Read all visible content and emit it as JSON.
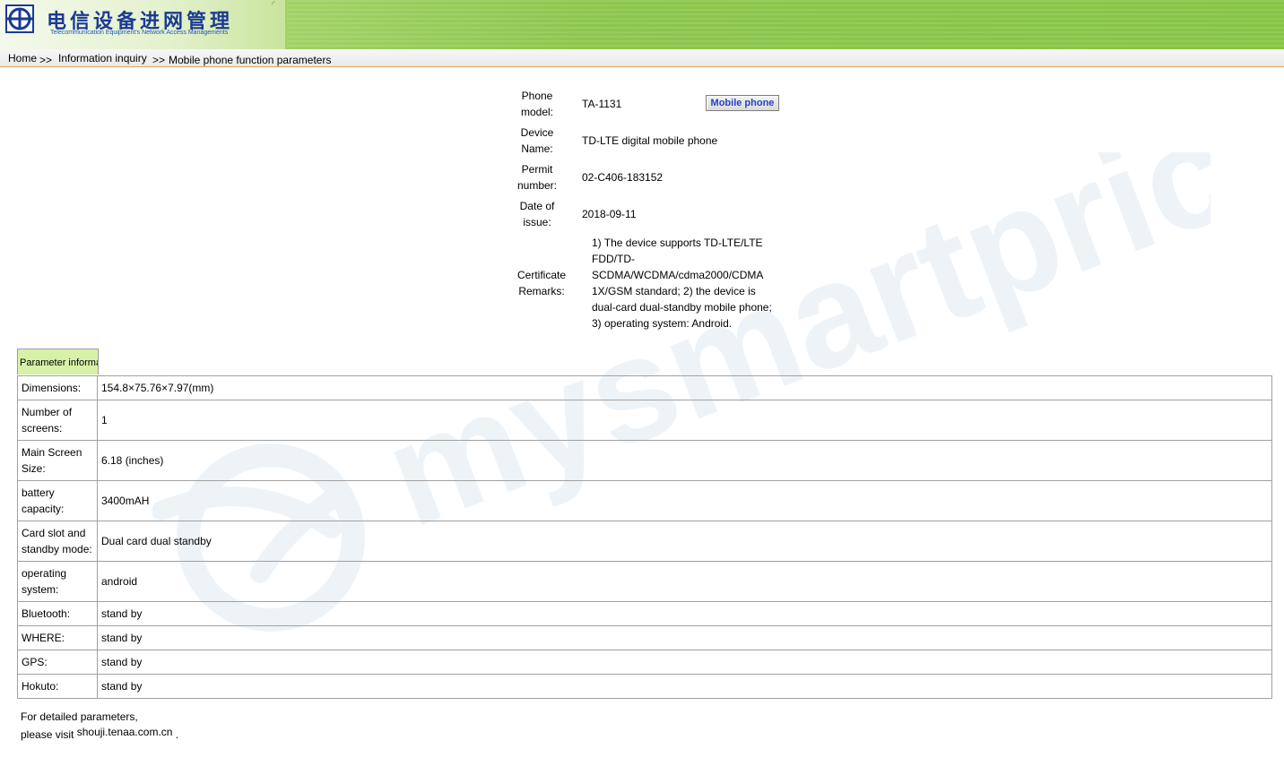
{
  "header": {
    "title_cn": "电信设备进网管理",
    "title_en": "Telecommunication Equipment's Network Access Managements"
  },
  "breadcrumb": {
    "home": "Home",
    "sep1": ">>",
    "info": "Information inquiry",
    "sep2": ">>",
    "current": "Mobile phone function parameters"
  },
  "certificate": {
    "phone_model_label": "Phone model:",
    "phone_model": "TA-1131",
    "type_button": "Mobile phone",
    "device_name_label": "Device Name:",
    "device_name": "TD-LTE digital mobile phone",
    "permit_label": "Permit number:",
    "permit_number": "02-C406-183152",
    "date_label": "Date of issue:",
    "date": "2018-09-11",
    "remarks_label": "Certificate Remarks:",
    "remarks": "1) The device supports TD-LTE/LTE FDD/TD-SCDMA/WCDMA/cdma2000/CDMA 1X/GSM standard; 2) the device is dual-card dual-standby mobile phone; 3) operating system: Android."
  },
  "parameters": {
    "tab_label": "Parameter information",
    "rows": [
      {
        "label": "Dimensions:",
        "value": "154.8×75.76×7.97(mm)"
      },
      {
        "label": "Number of screens:",
        "value": "1"
      },
      {
        "label": "Main Screen Size:",
        "value": "6.18 (inches)"
      },
      {
        "label": "battery capacity:",
        "value": "3400mAH"
      },
      {
        "label": "Card slot and standby mode:",
        "value": "Dual card dual standby"
      },
      {
        "label": "operating system:",
        "value": "android"
      },
      {
        "label": "Bluetooth:",
        "value": "stand by"
      },
      {
        "label": "WHERE:",
        "value": "stand by"
      },
      {
        "label": "GPS:",
        "value": "stand by"
      },
      {
        "label": "Hokuto:",
        "value": "stand by"
      }
    ]
  },
  "footer": {
    "line1": "For detailed parameters,",
    "line2_prefix": "please visit",
    "link": "shouji.tenaa.com.cn",
    "line2_suffix": "."
  },
  "watermark": {
    "text": "mysmartprice"
  },
  "colors": {
    "banner_green": "#8dc74e",
    "logo_blue": "#1b3a93",
    "tab_green": "#d6f2a9",
    "button_text": "#2740c7",
    "breadcrumb_border": "#e6a35c",
    "watermark": "#eef3f8"
  }
}
